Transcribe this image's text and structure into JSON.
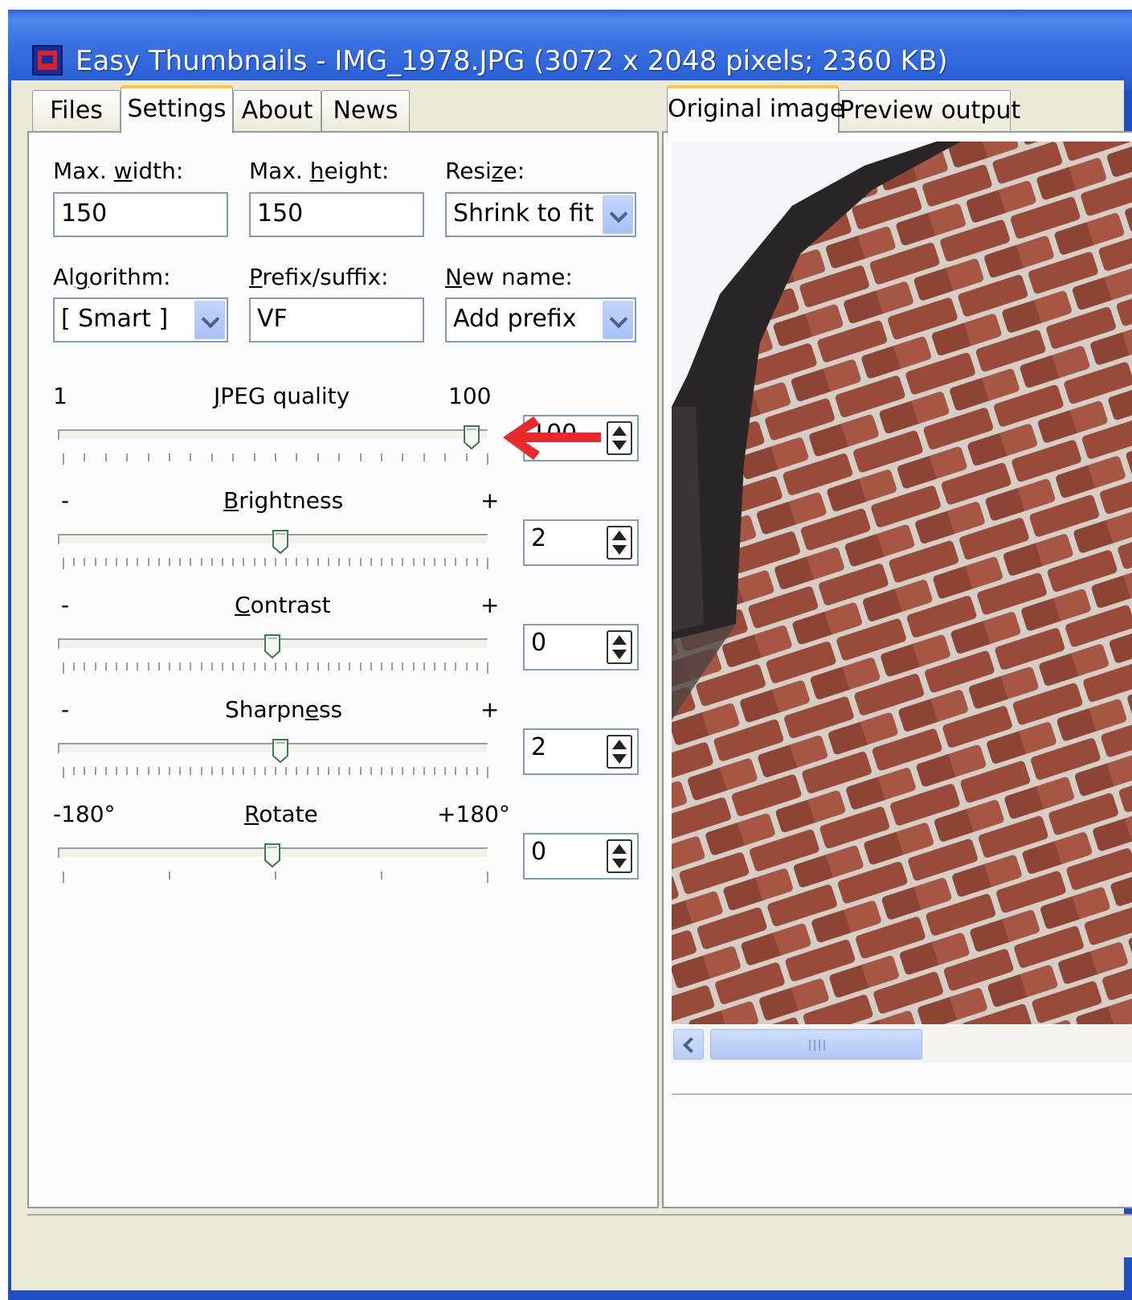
{
  "window": {
    "title": "Easy Thumbnails - IMG_1978.JPG  (3072 x 2048 pixels;  2360 KB)"
  },
  "left_tabs": [
    {
      "label": "Files"
    },
    {
      "label": "Settings"
    },
    {
      "label": "About"
    },
    {
      "label": "News"
    }
  ],
  "settings": {
    "max_width": {
      "label_pre": "Max. ",
      "label_key": "w",
      "label_post": "idth:",
      "value": "150"
    },
    "max_height": {
      "label_pre": "Max. ",
      "label_key": "h",
      "label_post": "eight:",
      "value": "150"
    },
    "resize": {
      "label_pre": "Resi",
      "label_key": "z",
      "label_post": "e:",
      "value": "Shrink to fit"
    },
    "algorithm": {
      "label_pre": "Al",
      "label_key": "g",
      "label_post": "orithm:",
      "value": "[ Smart ]"
    },
    "prefix_suffix": {
      "label_pre": "",
      "label_key": "P",
      "label_post": "refix/suffix:",
      "value": "VF"
    },
    "new_name": {
      "label_pre": "",
      "label_key": "N",
      "label_post": "ew name:",
      "value": "Add prefix"
    }
  },
  "sliders": {
    "jpeg": {
      "min_label": "1",
      "title_pre": "",
      "title_key": "J",
      "title_post": "PEG quality",
      "max_label": "100",
      "value": "100",
      "level": 1.0
    },
    "brightness": {
      "min_label": "-",
      "title_pre": "",
      "title_key": "B",
      "title_post": "rightness",
      "max_label": "+",
      "value": "2",
      "level": 0.52
    },
    "contrast": {
      "min_label": "-",
      "title_pre": "",
      "title_key": "C",
      "title_post": "ontrast",
      "max_label": "+",
      "value": "0",
      "level": 0.5
    },
    "sharpness": {
      "min_label": "-",
      "title_pre": "Sharpn",
      "title_key": "e",
      "title_post": "ss",
      "max_label": "+",
      "value": "2",
      "level": 0.52
    },
    "rotate": {
      "min_label": "-180°",
      "title_pre": "",
      "title_key": "R",
      "title_post": "otate",
      "max_label": "+180°",
      "value": "0",
      "level": 0.5
    }
  },
  "right_tabs": [
    {
      "label": "Original image"
    },
    {
      "label": "Preview output"
    }
  ],
  "colors": {
    "title_bar": "#2559d2",
    "annotation_arrow": "#e8282a",
    "brick": "#9a4a38",
    "mortar": "#d6d2cc"
  }
}
